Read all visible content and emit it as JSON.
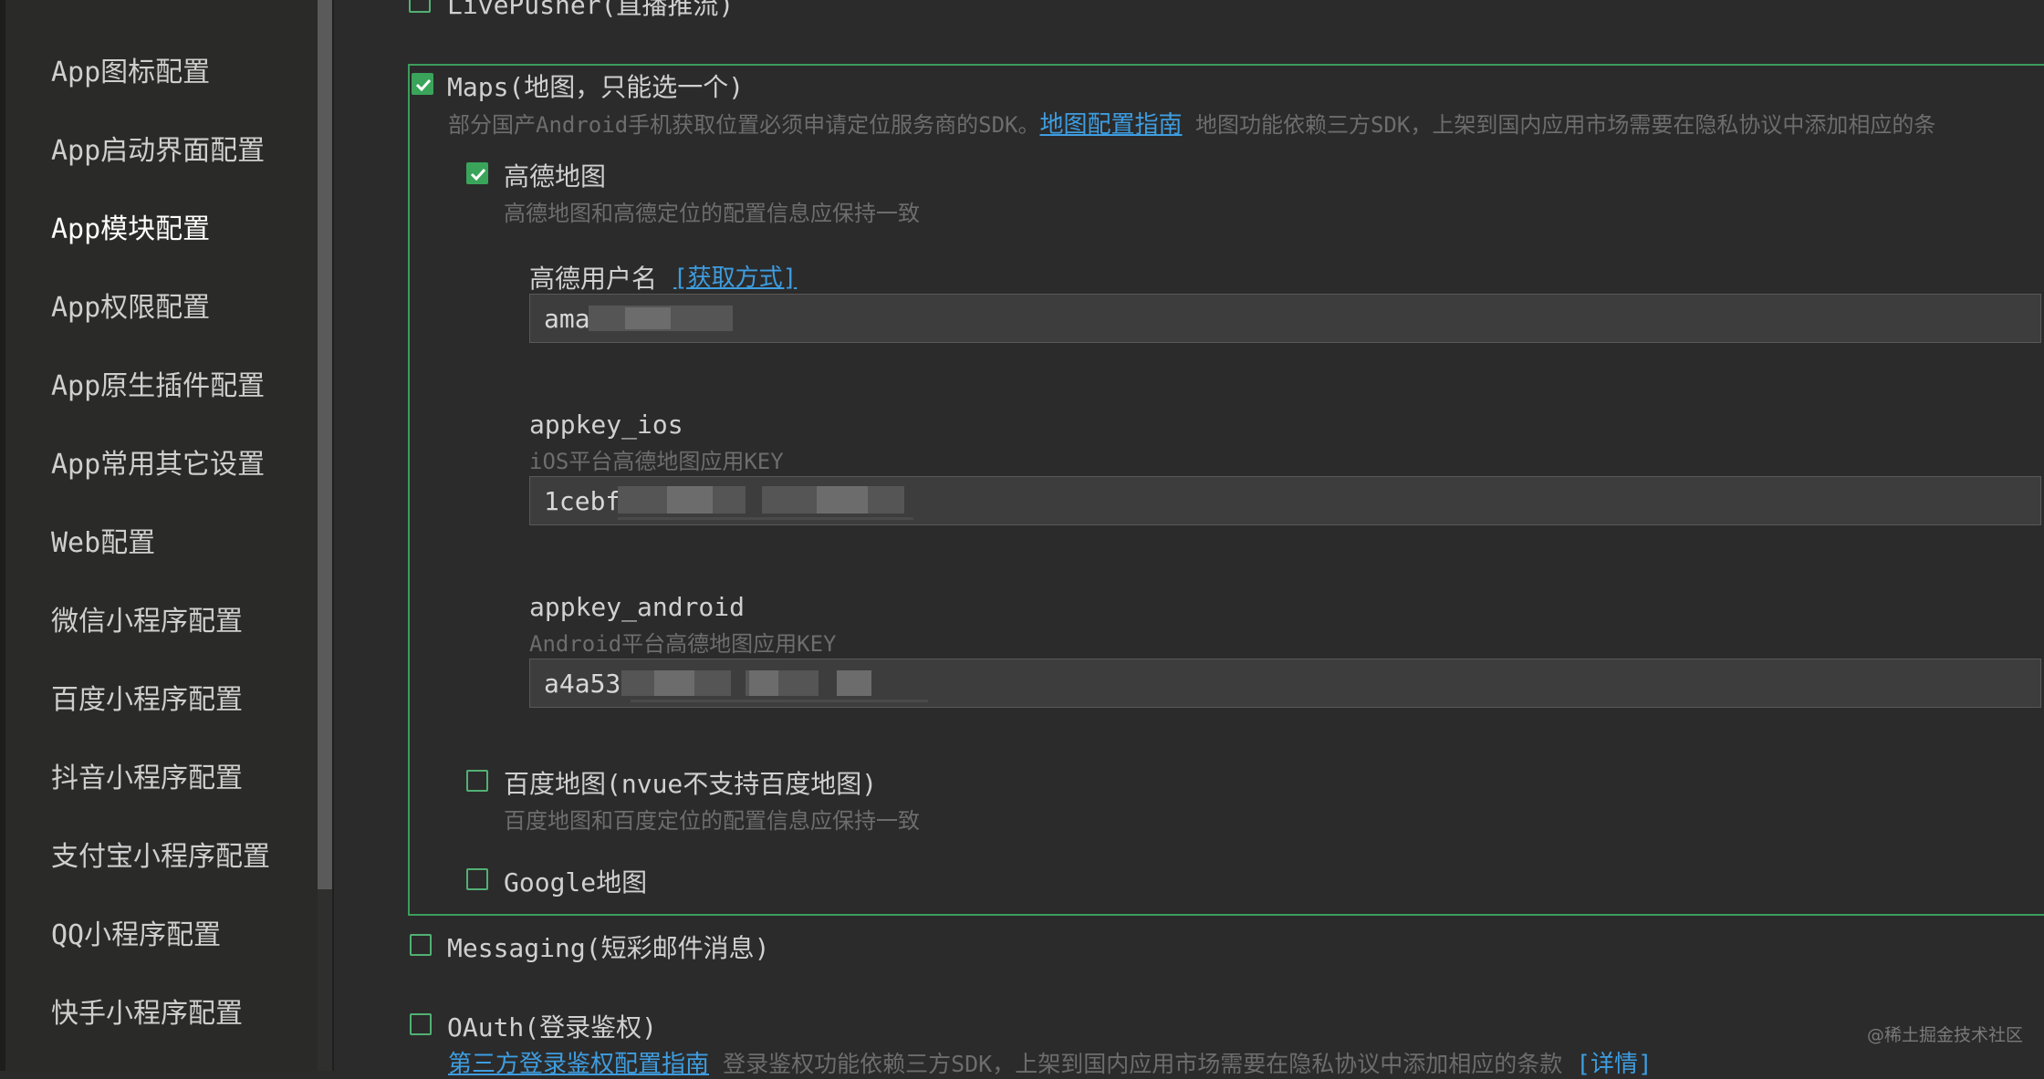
{
  "sidebar": {
    "items": [
      {
        "label": "App图标配置"
      },
      {
        "label": "App启动界面配置"
      },
      {
        "label": "App模块配置",
        "active": true
      },
      {
        "label": "App权限配置"
      },
      {
        "label": "App原生插件配置"
      },
      {
        "label": "App常用其它设置"
      },
      {
        "label": "Web配置"
      },
      {
        "label": "微信小程序配置"
      },
      {
        "label": "百度小程序配置"
      },
      {
        "label": "抖音小程序配置"
      },
      {
        "label": "支付宝小程序配置"
      },
      {
        "label": "QQ小程序配置"
      },
      {
        "label": "快手小程序配置"
      }
    ]
  },
  "modules": {
    "livepusher": {
      "label": "LivePusher(直播推流)",
      "checked": false
    },
    "maps": {
      "label": "Maps(地图，只能选一个)",
      "checked": true,
      "desc_prefix": "部分国产Android手机获取位置必须申请定位服务商的SDK。",
      "guide_link": "地图配置指南",
      "desc_suffix": "地图功能依赖三方SDK，上架到国内应用市场需要在隐私协议中添加相应的条",
      "amap": {
        "label": "高德地图",
        "checked": true,
        "hint": "高德地图和高德定位的配置信息应保持一致",
        "username_label": "高德用户名",
        "username_link": "[获取方式]",
        "username_value": "ama",
        "ios_label": "appkey_ios",
        "ios_hint": "iOS平台高德地图应用KEY",
        "ios_value": "1cebf",
        "android_label": "appkey_android",
        "android_hint": "Android平台高德地图应用KEY",
        "android_value": "a4a535"
      },
      "baidu": {
        "label": "百度地图(nvue不支持百度地图)",
        "checked": false,
        "hint": "百度地图和百度定位的配置信息应保持一致"
      },
      "google": {
        "label": "Google地图",
        "checked": false
      }
    },
    "messaging": {
      "label": "Messaging(短彩邮件消息)",
      "checked": false
    },
    "oauth": {
      "label": "OAuth(登录鉴权)",
      "checked": false,
      "guide_link": "第三方登录鉴权配置指南",
      "desc": "登录鉴权功能依赖三方SDK，上架到国内应用市场需要在隐私协议中添加相应的条款",
      "detail_link": "[详情]"
    }
  },
  "watermark": "@稀土掘金技术社区",
  "colors": {
    "accent_green": "#3aa45a",
    "link_blue": "#3e9de0",
    "background": "#2b2b2b"
  }
}
